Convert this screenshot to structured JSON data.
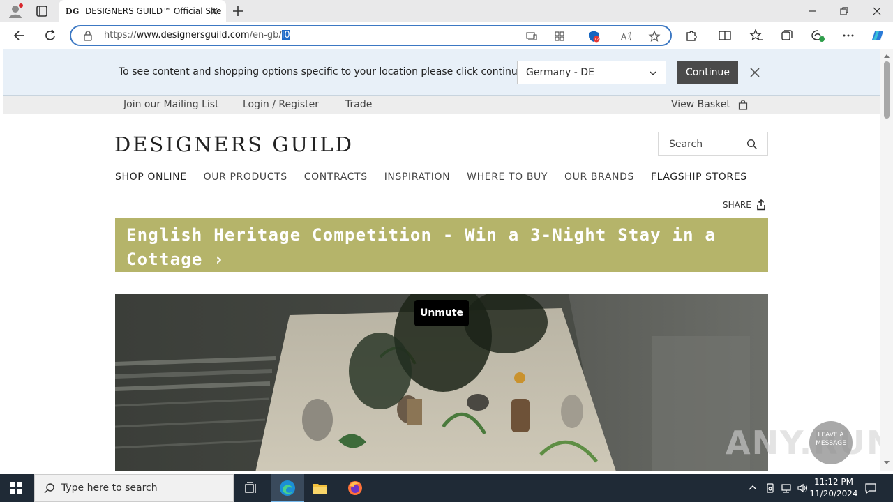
{
  "browser": {
    "tab": {
      "favicon_text": "DG",
      "title": "DESIGNERS GUILD™ Official Site"
    },
    "address": {
      "scheme": "https://",
      "host": "www.designersguild.com",
      "path": "/en-gb/",
      "selected": "l0"
    }
  },
  "location_prompt": {
    "message": "To see content and shopping options specific to your location please click continue",
    "selected_country": "Germany - DE",
    "continue_label": "Continue"
  },
  "utility_nav": {
    "mailing_list": "Join our Mailing List",
    "login": "Login / Register",
    "trade": "Trade",
    "basket": "View Basket"
  },
  "header": {
    "logo": "DESIGNERS GUILD",
    "search_placeholder": "Search"
  },
  "main_nav": {
    "items": [
      "SHOP ONLINE",
      "OUR PRODUCTS",
      "CONTRACTS",
      "INSPIRATION",
      "WHERE TO BUY",
      "OUR BRANDS",
      "FLAGSHIP STORES"
    ]
  },
  "share_label": "SHARE",
  "promo": {
    "text": "English Heritage Competition - Win a 3-Night Stay in a Cottage ›"
  },
  "hero": {
    "unmute_label": "Unmute"
  },
  "overlay": {
    "watermark": "ANY.RUN",
    "chat_label": "LEAVE A MESSAGE"
  },
  "taskbar": {
    "search_placeholder": "Type here to search",
    "time": "11:12 PM",
    "date": "11/20/2024"
  },
  "colors": {
    "promo_bg": "#b5b46a",
    "location_bar_bg": "#e8f0f8",
    "continue_bg": "#4a4a4a",
    "address_border": "#3c78c3",
    "taskbar_bg": "#1f2a36"
  }
}
